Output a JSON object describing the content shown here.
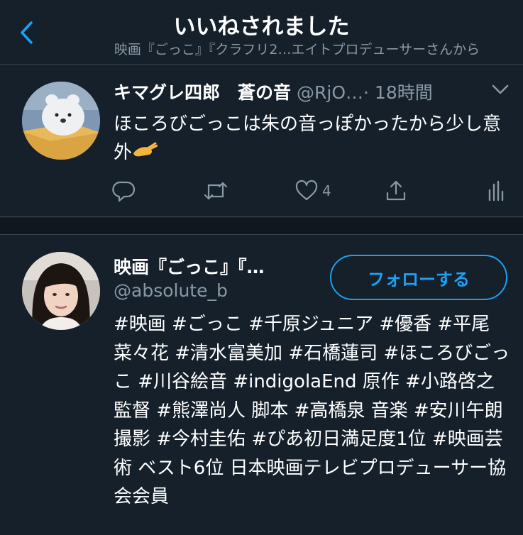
{
  "header": {
    "title": "いいねされました",
    "subtitle": "映画『ごっこ』『クラフリ2…エイトプロデューサーさんから"
  },
  "tweet": {
    "name": "キマグレ四郎　蒼の音",
    "handle": "@RjO…",
    "time": "· 18時間",
    "text": "ほころびごっこは朱の音っぽかったから少し意外",
    "emoji_icon": "pinching-hand-icon",
    "like_count": "4"
  },
  "user": {
    "name": "映画『ごっこ』『…",
    "handle": "@absolute_b",
    "follow_label": "フォローする",
    "bio": "#映画 #ごっこ #千原ジュニア #優香 #平尾菜々花 #清水富美加 #石橋蓮司 #ほころびごっこ #川谷絵音 #indigolaEnd 原作 #小路啓之 監督 #熊澤尚人 脚本 #高橋泉 音楽 #安川午朗 撮影 #今村圭佑 #ぴあ初日満足度1位 #映画芸術 ベスト6位 日本映画テレビプロデューサー協会会員"
  },
  "colors": {
    "background": "#15202b",
    "accent": "#1da1f2",
    "secondary_text": "#8899a6",
    "divider": "#38444d"
  }
}
